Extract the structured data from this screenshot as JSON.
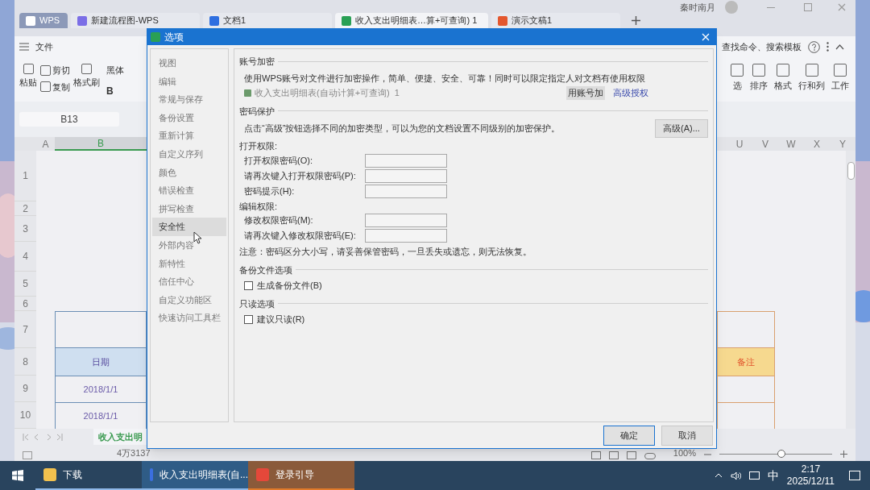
{
  "title_bar": {
    "user": "秦时南月"
  },
  "tabs": [
    {
      "label": "WPS",
      "kind": "home",
      "selected": false
    },
    {
      "label": "新建流程图-WPS",
      "kind": "flow",
      "selected": false
    },
    {
      "label": "文档1",
      "kind": "doc",
      "selected": false
    },
    {
      "label": "收入支出明细表…算+可查询) 1",
      "kind": "sheet",
      "selected": true
    },
    {
      "label": "演示文稿1",
      "kind": "slides",
      "selected": false
    }
  ],
  "menu": {
    "file": "文件",
    "search": "查找命令、搜索模板"
  },
  "ribbon_left": [
    {
      "label": "粘贴",
      "kind": "big"
    },
    {
      "label": "剪切",
      "kind": "small"
    },
    {
      "label": "复制",
      "kind": "small"
    },
    {
      "label": "格式刷",
      "kind": "big"
    }
  ],
  "font_box": "黑体",
  "bold": "B",
  "ribbon_right": [
    "选",
    "排序",
    "格式",
    "行和列",
    "工作"
  ],
  "name_box": "B13",
  "columns_left": [
    {
      "label": "A",
      "selected": false
    },
    {
      "label": "B",
      "selected": true
    }
  ],
  "columns_right": [
    "U",
    "V",
    "W",
    "X",
    "Y"
  ],
  "rows": [
    "1",
    "2",
    "3",
    "4",
    "5",
    "6",
    "7",
    "8",
    "9",
    "10"
  ],
  "table": {
    "header_left": "日期",
    "header_right": "备注",
    "dates": [
      "2018/1/1",
      "2018/1/1"
    ]
  },
  "sheet_tab": "收入支出明",
  "status": {
    "count": "4万3137",
    "zoom": "100%",
    "zoom_slider": {
      "level": 0.55
    }
  },
  "dialog": {
    "title": "选项",
    "nav": [
      {
        "label": "视图",
        "selected": false
      },
      {
        "label": "编辑",
        "selected": false
      },
      {
        "label": "常规与保存",
        "selected": false
      },
      {
        "label": "备份设置",
        "selected": false
      },
      {
        "label": "重新计算",
        "selected": false
      },
      {
        "label": "自定义序列",
        "selected": false
      },
      {
        "label": "颜色",
        "selected": false
      },
      {
        "label": "错误检查",
        "selected": false
      },
      {
        "label": "拼写检查",
        "selected": false
      },
      {
        "label": "安全性",
        "selected": true
      },
      {
        "label": "外部内容",
        "selected": false
      },
      {
        "label": "新特性",
        "selected": false
      },
      {
        "label": "信任中心",
        "selected": false
      },
      {
        "label": "自定义功能区",
        "selected": false
      },
      {
        "label": "快速访问工具栏",
        "selected": false
      }
    ],
    "account": {
      "heading": "账号加密",
      "text": "使用WPS账号对文件进行加密操作，简单、便捷、安全、可靠！同时可以限定指定人对文档有使用权限",
      "file": "收入支出明细表(自动计算+可查询)  1",
      "button": "用账号加",
      "link": "高级授权"
    },
    "password": {
      "heading": "密码保护",
      "text": "点击“高级”按钮选择不同的加密类型，可以为您的文档设置不同级别的加密保护。",
      "button": "高级(A)..."
    },
    "open": {
      "heading": "打开权限:",
      "fields": [
        "打开权限密码(O):",
        "请再次键入打开权限密码(P):",
        "密码提示(H):"
      ]
    },
    "edit": {
      "heading": "编辑权限:",
      "fields": [
        "修改权限密码(M):",
        "请再次键入修改权限密码(E):"
      ]
    },
    "note": "注意：密码区分大小写，请妥善保管密码，一旦丢失或遗忘，则无法恢复。",
    "backup": {
      "heading": "备份文件选项",
      "option": {
        "label": "生成备份文件(B)",
        "checked": false
      }
    },
    "readonly": {
      "heading": "只读选项",
      "option": {
        "label": "建议只读(R)",
        "checked": false
      }
    },
    "ok": "确定",
    "cancel": "取消"
  },
  "taskbar": {
    "items": [
      {
        "label": "下载",
        "kind": "folder",
        "selected": false
      },
      {
        "label": "收入支出明细表(自...",
        "kind": "wps",
        "selected": true
      },
      {
        "label": "登录引导",
        "kind": "login",
        "selected": false
      }
    ],
    "ime": "中",
    "time": "2:17",
    "date": "2025/12/11"
  }
}
